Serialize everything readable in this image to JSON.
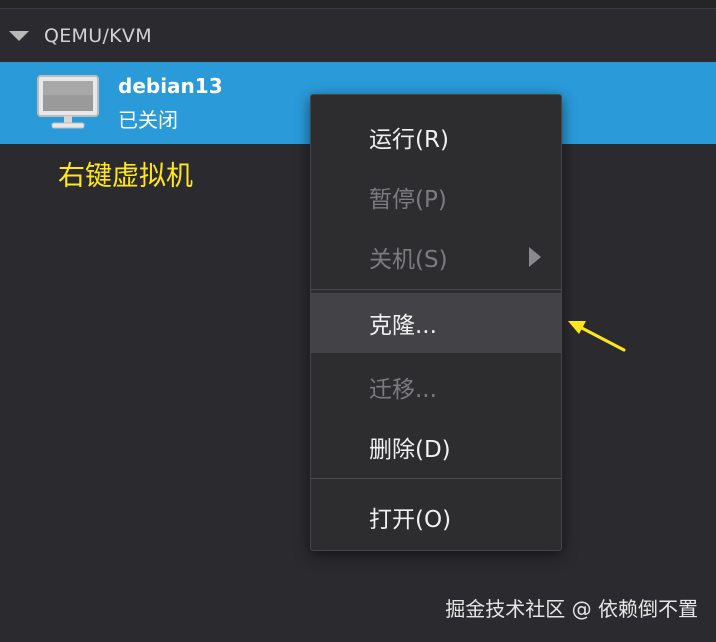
{
  "group": {
    "label": "QEMU/KVM"
  },
  "vm": {
    "name": "debian13",
    "status": "已关闭"
  },
  "annotation": {
    "text": "右键虚拟机",
    "color": "#ffe81a"
  },
  "context_menu": {
    "items": [
      {
        "label": "运行(R)",
        "enabled": true
      },
      {
        "label": "暂停(P)",
        "enabled": false
      },
      {
        "label": "关机(S)",
        "enabled": false,
        "has_submenu": true
      },
      {
        "label": "克隆...",
        "enabled": true,
        "highlighted": true
      },
      {
        "label": "迁移...",
        "enabled": false
      },
      {
        "label": "删除(D)",
        "enabled": true
      },
      {
        "label": "打开(O)",
        "enabled": true
      }
    ]
  },
  "watermark": {
    "text": "掘金技术社区 @ 依赖倒不置"
  },
  "colors": {
    "selection": "#2a9ad9",
    "background": "#2b2b2f",
    "menu_bg": "#2d2d30",
    "highlight_arrow": "#ffe81a"
  },
  "icons": {
    "group_toggle": "triangle-down-icon",
    "vm": "monitor-icon",
    "submenu": "triangle-right-icon",
    "annotation_pointer": "arrow-pointer-icon"
  }
}
